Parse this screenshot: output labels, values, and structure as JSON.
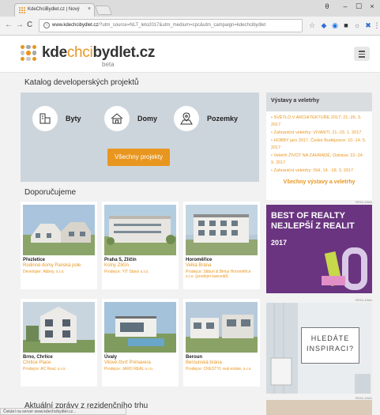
{
  "browser": {
    "tab_title": "KdeChciBydlet.cz | Nový",
    "tab_close": "×",
    "win_min": "–",
    "win_max": "☐",
    "win_close": "×",
    "user_glyph": "θ",
    "url_host": "www.kdechcibydlet.cz",
    "url_rest": "/?utm_source=NLT_leto2017&utm_medium=cpc&utm_campaign=kdechcibydlet",
    "back": "←",
    "forward": "→",
    "reload": "C"
  },
  "header": {
    "logo_part1": "kde",
    "logo_part2": "chci",
    "logo_part3": "bydlet.cz",
    "logo_beta": "beta"
  },
  "catalog": {
    "title": "Katalog developerských projektů",
    "items": [
      {
        "label": "Byty",
        "icon": "apartment-icon"
      },
      {
        "label": "Domy",
        "icon": "house-icon"
      },
      {
        "label": "Pozemky",
        "icon": "land-icon"
      }
    ],
    "button": "Všechny projekty"
  },
  "events": {
    "title": "Výstavy a veletrhy",
    "items": [
      "SVĚTLO V ARCHITEKTUŘE 2017: 21.-26. 3. 2017",
      "Zahraniční veletrhy: VIVANTI, 21.-23. 1. 2017",
      "HOBBY jaro 2017, České Budějovice: 10.-14. 5. 2017",
      "Veletrh ŽIVOT NA ZAHRADĚ, Ostrava: 22.-24. 9. 2017",
      "Zahraniční veletrhy: ISH, 14. -18. 3. 2017"
    ],
    "link": "Všechny výstavy a veletrhy"
  },
  "recommended": {
    "title": "Doporučujeme",
    "cards": [
      {
        "location": "Přezletice",
        "project": "Rodinné domy Panská pole",
        "dev_label": "Developer:",
        "dev_name": "Abbey, s.r.o."
      },
      {
        "location": "Praha 5, Zličín",
        "project": "Kolny Zličín",
        "dev_label": "Prodejce:",
        "dev_name": "YIT Stavo s.r.o."
      },
      {
        "location": "Horoměřice",
        "project": "Velká Brána",
        "dev_label": "Prodejce:",
        "dev_name": "Stiburi & Bimui Horoměřice s.r.o. (prodejní kancelář)"
      },
      {
        "location": "Brno, Chrlice",
        "project": "Chrlice Place",
        "dev_label": "Prodejce:",
        "dev_name": "AC Real, s.r.o."
      },
      {
        "location": "Úvaly",
        "project": "Vilové čtvrť Primavera",
        "dev_label": "Prodejce:",
        "dev_name": "JARO REAL s.r.o."
      },
      {
        "location": "Beroun",
        "project": "Berounská brána",
        "dev_label": "Prodejce:",
        "dev_name": "CRESTYL real estate, s.r.o."
      }
    ]
  },
  "ads": {
    "label": "REKLAMA",
    "ad1_line1": "BEST OF REALTY",
    "ad1_line2": "NEJLEPŠÍ Z REALIT",
    "ad1_line3": "2017",
    "ad2_line1": "HLEDÁTE",
    "ad2_line2": "INSPIRACI?"
  },
  "news": {
    "title": "Aktuální zprávy z rezidenčního trhu"
  },
  "status_bar": "Čekání na server www.kdechcibydlet.cz..."
}
